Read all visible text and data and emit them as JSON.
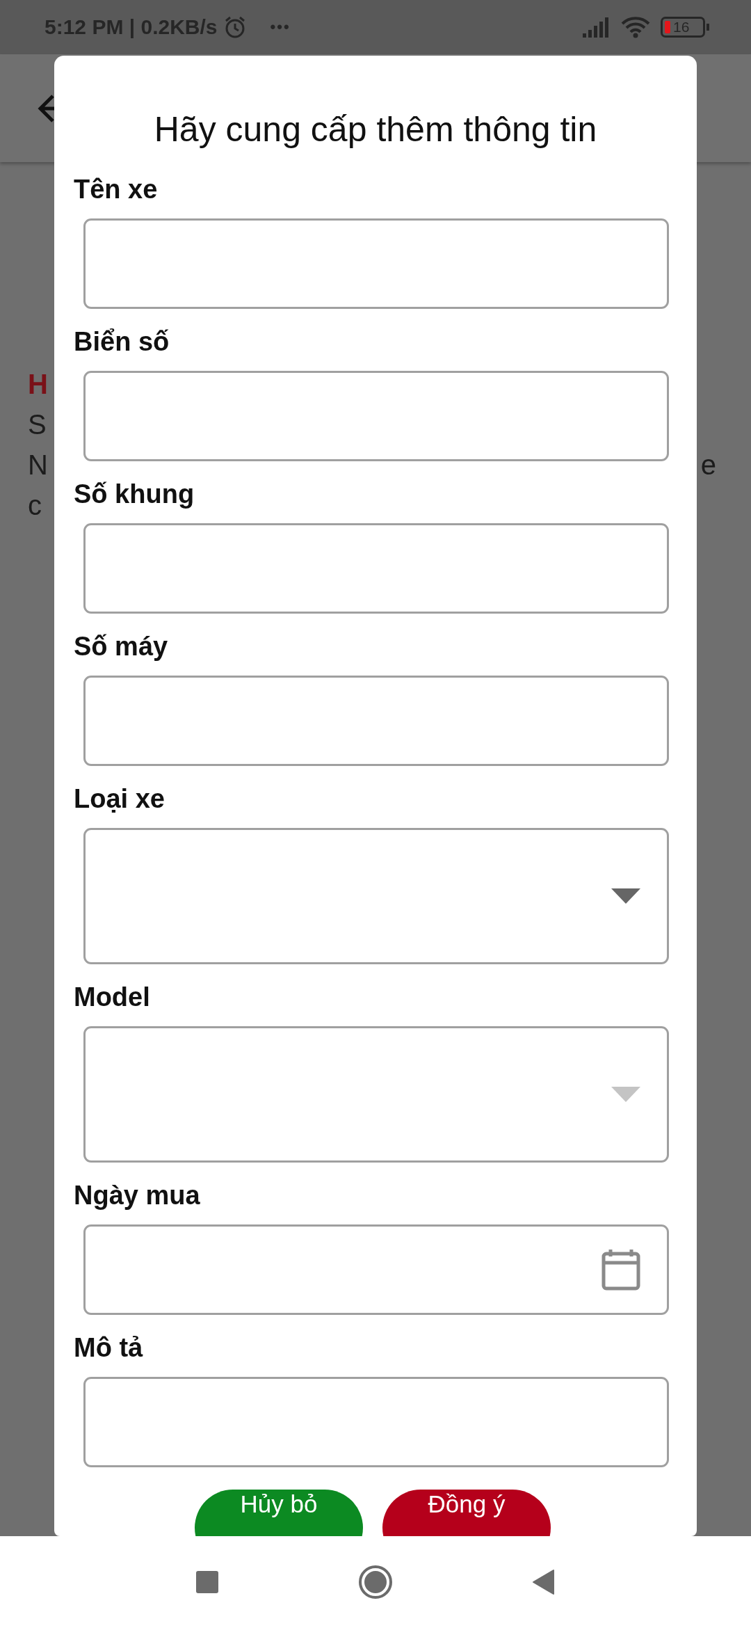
{
  "status_bar": {
    "time": "5:12 PM | 0.2KB/s",
    "more": "•••",
    "battery": "16"
  },
  "background": {
    "heading_fragment": "H",
    "line_fragments": [
      "S",
      "N",
      "c"
    ],
    "right_fragment": "e"
  },
  "dialog": {
    "title": "Hãy cung cấp thêm thông tin",
    "fields": [
      {
        "label": "Tên xe",
        "kind": "text"
      },
      {
        "label": "Biển số",
        "kind": "text"
      },
      {
        "label": "Số khung",
        "kind": "text"
      },
      {
        "label": "Số máy",
        "kind": "text"
      },
      {
        "label": "Loại xe",
        "kind": "dropdown",
        "disabled": false
      },
      {
        "label": "Model",
        "kind": "dropdown",
        "disabled": true
      },
      {
        "label": "Ngày mua",
        "kind": "date"
      },
      {
        "label": "Mô tả",
        "kind": "text"
      }
    ],
    "buttons": [
      {
        "label": "Hủy bỏ",
        "kind": "cancel"
      },
      {
        "label": "Đồng ý",
        "kind": "confirm"
      }
    ]
  }
}
